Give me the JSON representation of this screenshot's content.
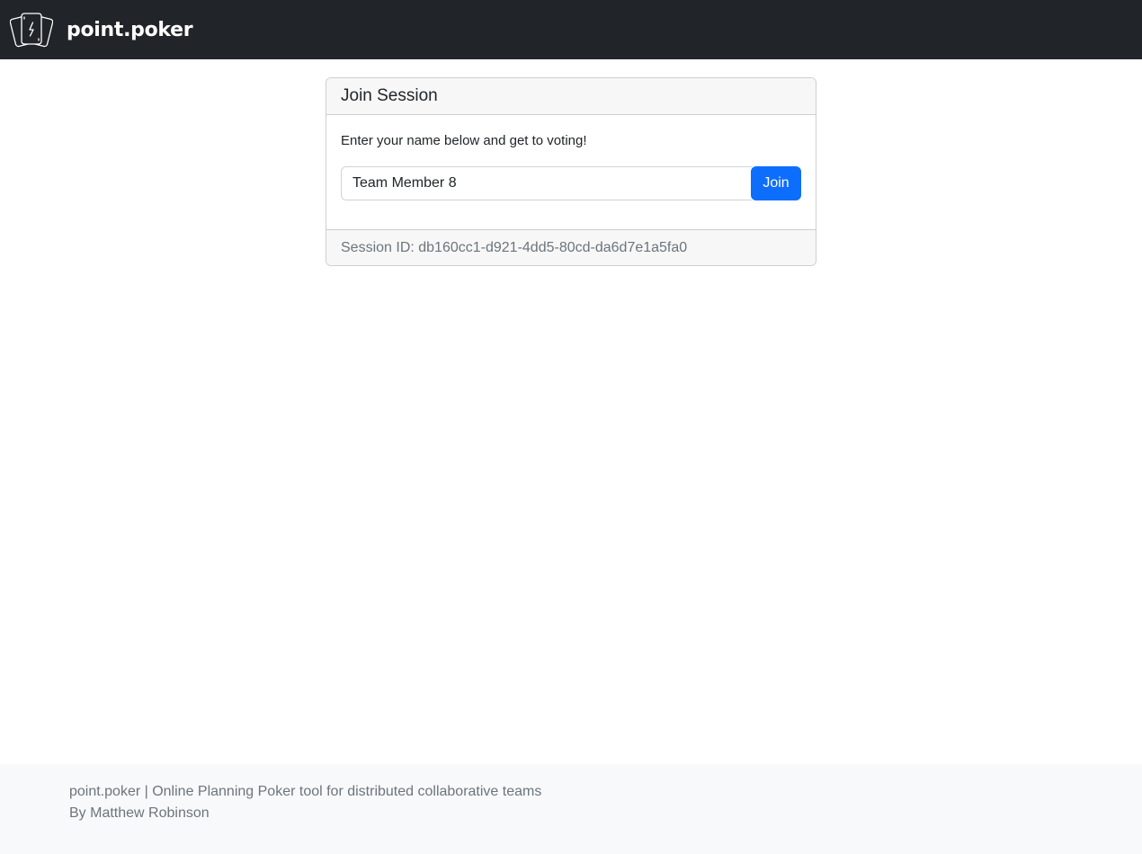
{
  "navbar": {
    "brand_name": "point.poker",
    "logo_icon": "playing-cards-lightning-icon"
  },
  "join_card": {
    "title": "Join Session",
    "instructions": "Enter your name below and get to voting!",
    "name_input_value": "Team Member 8",
    "join_label": "Join",
    "session_id_text": "Session ID: db160cc1-d921-4dd5-80cd-da6d7e1a5fa0"
  },
  "footer": {
    "tagline": "point.poker | Online Planning Poker tool for distributed collaborative teams",
    "author": "By Matthew Robinson"
  },
  "colors": {
    "navbar_bg": "#212529",
    "primary_button": "#0d6efd",
    "muted_text": "#6c757d",
    "footer_bg": "#f8f9fa"
  }
}
